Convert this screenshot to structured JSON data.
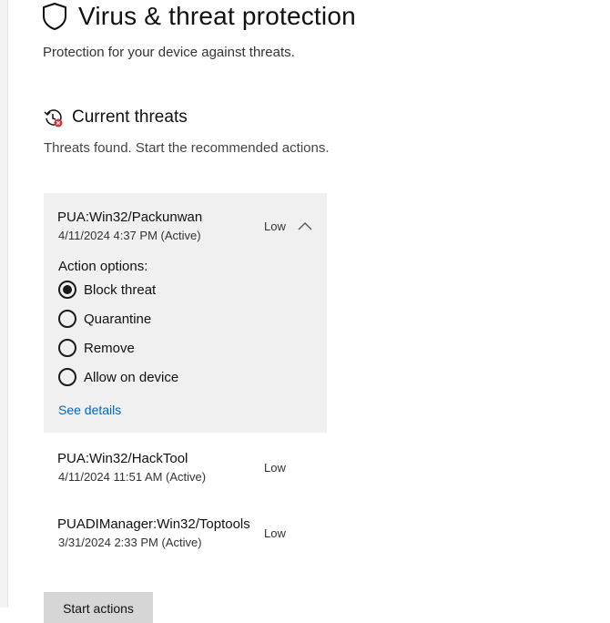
{
  "page": {
    "title": "Virus & threat protection",
    "subtitle": "Protection for your device against threats.",
    "icon": "shield-icon"
  },
  "current_threats": {
    "title": "Current threats",
    "icon": "clock-history-icon",
    "description": "Threats found. Start the recommended actions."
  },
  "threats": [
    {
      "name": "PUA:Win32/Packunwan",
      "date": "4/11/2024 4:37 PM (Active)",
      "level": "Low",
      "expanded": true,
      "action_options_label": "Action options:",
      "options": [
        {
          "label": "Block threat",
          "selected": true
        },
        {
          "label": "Quarantine",
          "selected": false
        },
        {
          "label": "Remove",
          "selected": false
        },
        {
          "label": "Allow on device",
          "selected": false
        }
      ],
      "details_link": "See details"
    },
    {
      "name": "PUA:Win32/HackTool",
      "date": "4/11/2024 11:51 AM (Active)",
      "level": "Low",
      "expanded": false
    },
    {
      "name": "PUADIManager:Win32/Toptools",
      "date": "3/31/2024 2:33 PM (Active)",
      "level": "Low",
      "expanded": false
    }
  ],
  "actions": {
    "start_label": "Start actions"
  },
  "colors": {
    "card_bg": "#f0f0f0",
    "link": "#0067c0",
    "button_bg": "#d6d6d6",
    "alert_red": "#d13438"
  }
}
